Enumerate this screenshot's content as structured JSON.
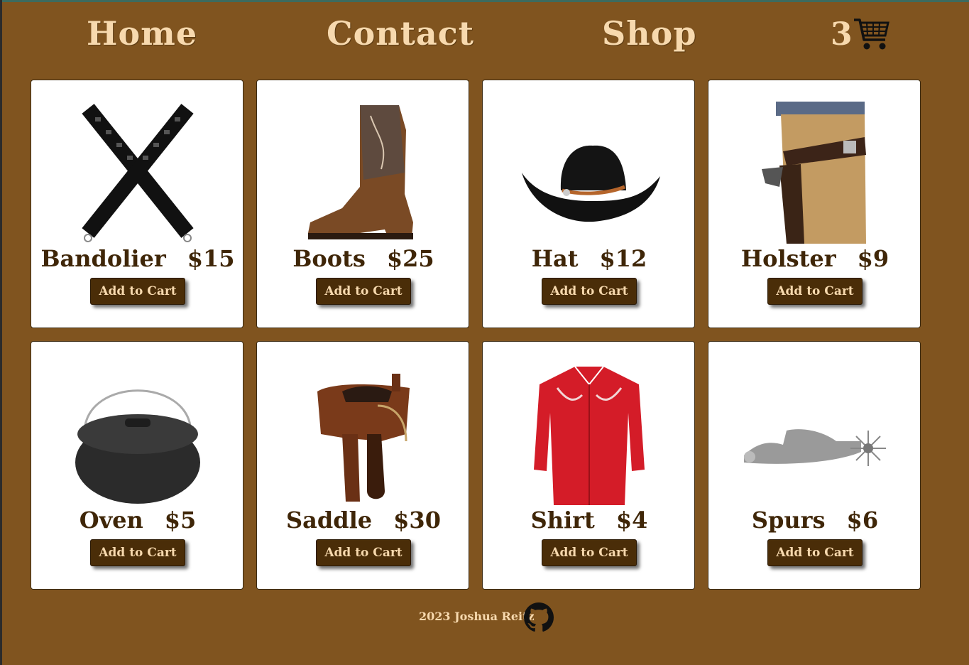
{
  "nav": {
    "home": "Home",
    "contact": "Contact",
    "shop": "Shop",
    "cart_count": "3"
  },
  "products": [
    {
      "name": "Bandolier",
      "price": "$15",
      "button": "Add to Cart",
      "icon": "bandolier-image"
    },
    {
      "name": "Boots",
      "price": "$25",
      "button": "Add to Cart",
      "icon": "boots-image"
    },
    {
      "name": "Hat",
      "price": "$12",
      "button": "Add to Cart",
      "icon": "hat-image"
    },
    {
      "name": "Holster",
      "price": "$9",
      "button": "Add to Cart",
      "icon": "holster-image"
    },
    {
      "name": "Oven",
      "price": "$5",
      "button": "Add to Cart",
      "icon": "oven-image"
    },
    {
      "name": "Saddle",
      "price": "$30",
      "button": "Add to Cart",
      "icon": "saddle-image"
    },
    {
      "name": "Shirt",
      "price": "$4",
      "button": "Add to Cart",
      "icon": "shirt-image"
    },
    {
      "name": "Spurs",
      "price": "$6",
      "button": "Add to Cart",
      "icon": "spurs-image"
    }
  ],
  "footer": {
    "text": "2023 Joshua Reitz",
    "icon": "github-icon"
  },
  "colors": {
    "background": "#80541f",
    "nav_text": "#f7d9ae",
    "title_text": "#3f2608",
    "button_bg": "#4a2d08"
  }
}
